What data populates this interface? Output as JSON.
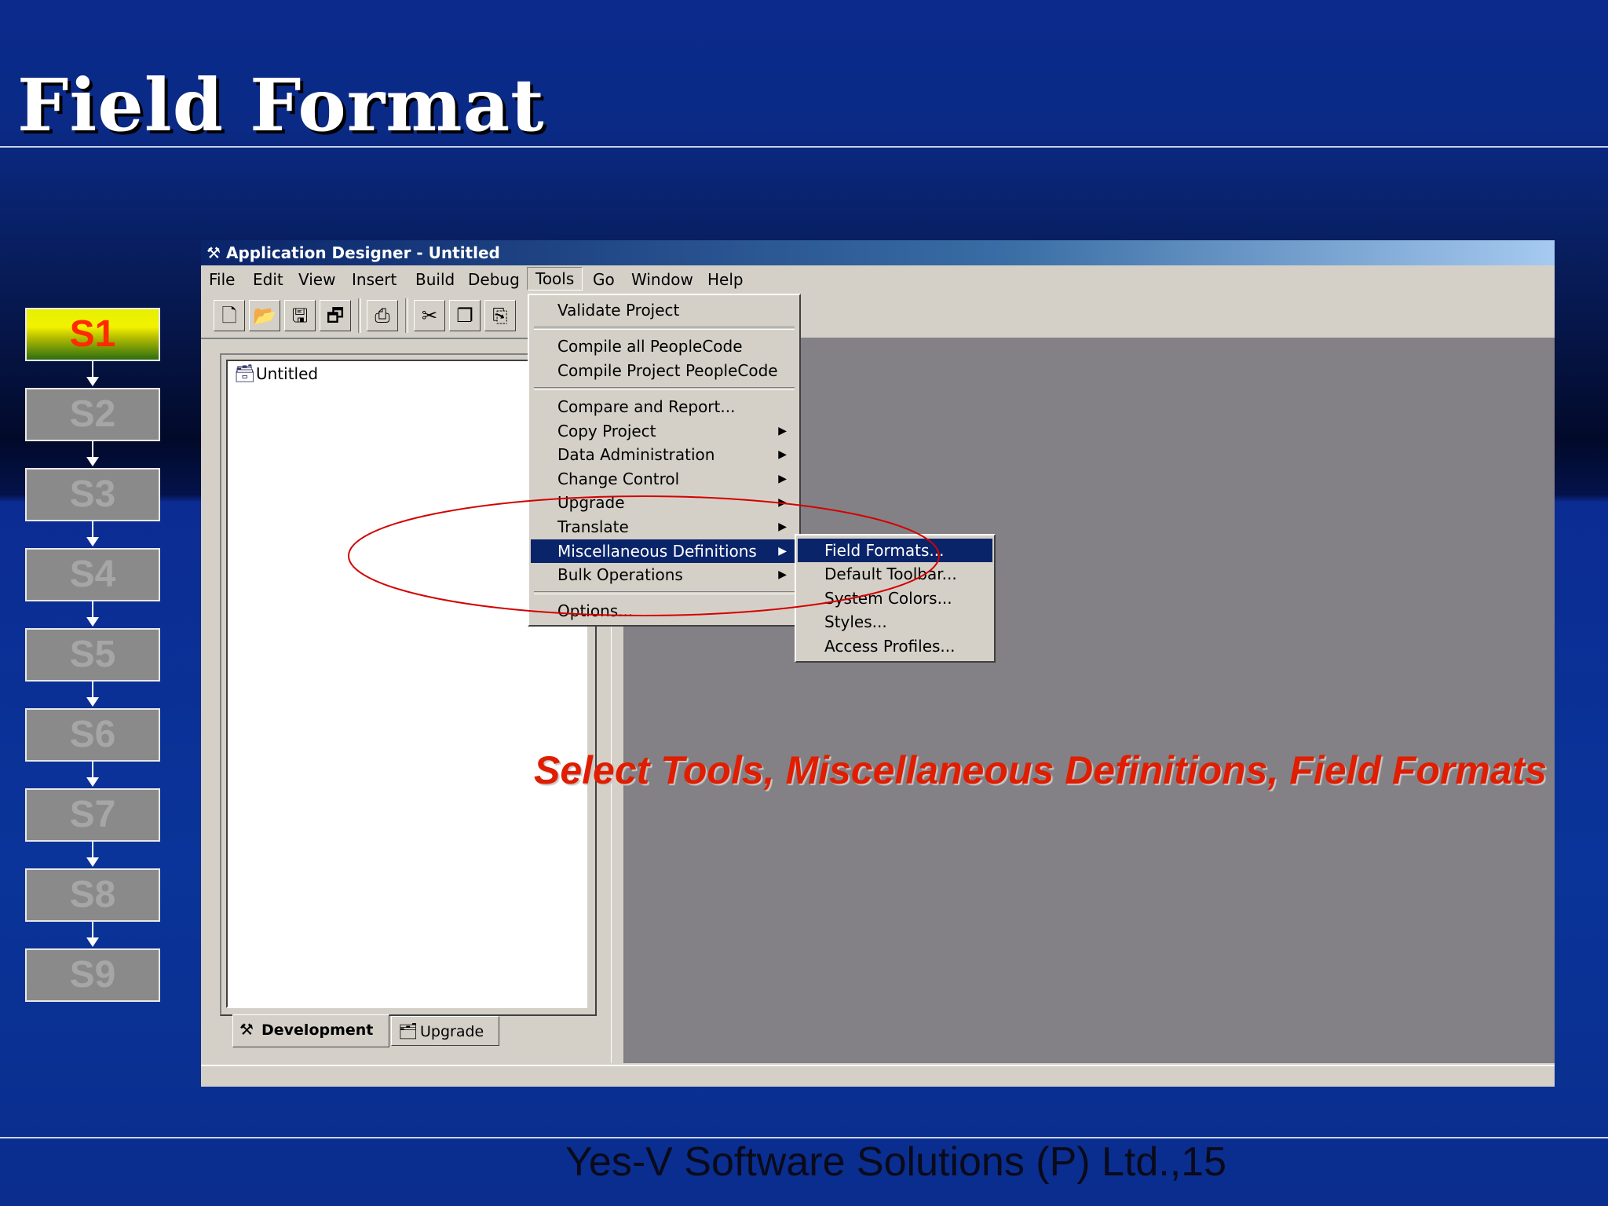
{
  "slide": {
    "title": "Field Format",
    "footer": "Yes-V Software Solutions (P) Ltd.,15",
    "instruction": "Select Tools, Miscellaneous Definitions, Field Formats"
  },
  "steps": [
    "S1",
    "S2",
    "S3",
    "S4",
    "S5",
    "S6",
    "S7",
    "S8",
    "S9"
  ],
  "active_step": "S1",
  "colors": {
    "accent_red": "#e01d00",
    "menu_highlight": "#0a246a",
    "workspace": "#838185"
  },
  "window": {
    "title": "Application Designer - Untitled",
    "menu": [
      "File",
      "Edit",
      "View",
      "Insert",
      "Build",
      "Debug",
      "Tools",
      "Go",
      "Window",
      "Help"
    ],
    "open_menu": "Tools",
    "toolbar_icons": [
      "new-icon",
      "open-icon",
      "save-icon",
      "save-all-icon",
      "print-icon",
      "cut-icon",
      "copy-icon",
      "paste-icon"
    ],
    "project_tree": {
      "root": "Untitled"
    },
    "tabs": {
      "development": "Development",
      "upgrade": "Upgrade"
    }
  },
  "tools_menu": {
    "validate": "Validate Project",
    "compile_all": "Compile all PeopleCode",
    "compile_project": "Compile Project PeopleCode",
    "compare": "Compare and Report...",
    "copy_project": "Copy Project",
    "data_admin": "Data Administration",
    "change_control": "Change Control",
    "upgrade": "Upgrade",
    "translate": "Translate",
    "misc_defs": "Miscellaneous Definitions",
    "bulk_ops": "Bulk Operations",
    "options": "Options..."
  },
  "misc_submenu": {
    "field_formats": "Field Formats...",
    "default_toolbar": "Default Toolbar...",
    "system_colors": "System Colors...",
    "styles": "Styles...",
    "access_profiles": "Access Profiles..."
  }
}
